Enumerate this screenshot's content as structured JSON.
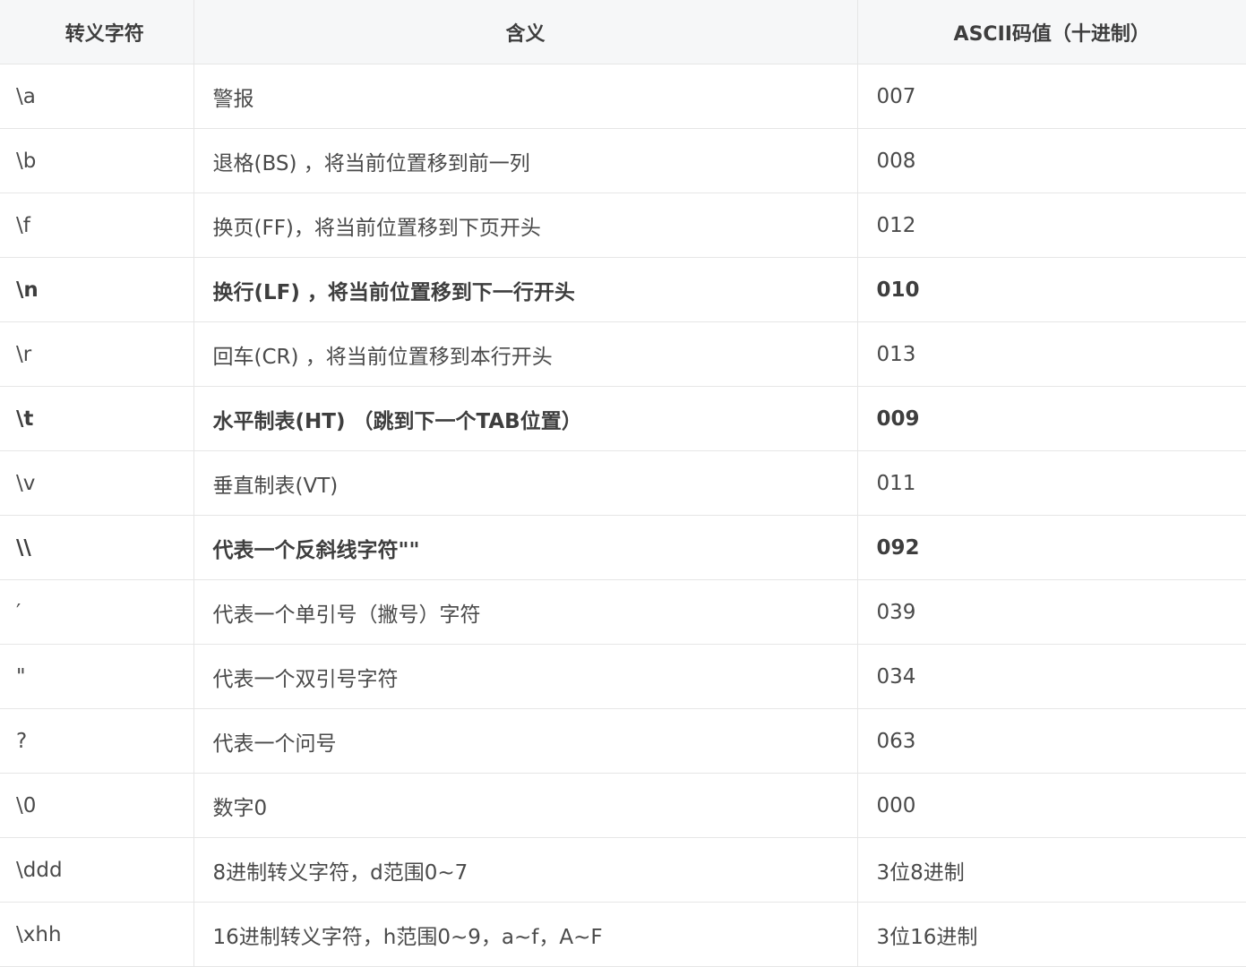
{
  "headers": [
    "转义字符",
    "含义",
    "ASCII码值（十进制）"
  ],
  "rows": [
    {
      "escape": "\\a",
      "meaning": "警报",
      "value": "007",
      "bold": false
    },
    {
      "escape": "\\b",
      "meaning": "退格(BS) ，将当前位置移到前一列",
      "value": "008",
      "bold": false
    },
    {
      "escape": "\\f",
      "meaning": "换页(FF)，将当前位置移到下页开头",
      "value": "012",
      "bold": false
    },
    {
      "escape": "\\n",
      "meaning": "换行(LF) ，将当前位置移到下一行开头",
      "value": "010",
      "bold": true
    },
    {
      "escape": "\\r",
      "meaning": "回车(CR) ，将当前位置移到本行开头",
      "value": "013",
      "bold": false
    },
    {
      "escape": "\\t",
      "meaning": "水平制表(HT) （跳到下一个TAB位置）",
      "value": "009",
      "bold": true
    },
    {
      "escape": "\\v",
      "meaning": "垂直制表(VT)",
      "value": "011",
      "bold": false
    },
    {
      "escape": "\\\\",
      "meaning": "代表一个反斜线字符\"\"",
      "value": "092",
      "bold": true
    },
    {
      "escape": "′",
      "meaning": "代表一个单引号（撇号）字符",
      "value": "039",
      "bold": false
    },
    {
      "escape": "\"",
      "meaning": "代表一个双引号字符",
      "value": "034",
      "bold": false
    },
    {
      "escape": "?",
      "meaning": "代表一个问号",
      "value": "063",
      "bold": false
    },
    {
      "escape": "\\0",
      "meaning": "数字0",
      "value": "000",
      "bold": false
    },
    {
      "escape": "\\ddd",
      "meaning": "8进制转义字符，d范围0~7",
      "value": "3位8进制",
      "bold": false
    },
    {
      "escape": "\\xhh",
      "meaning": "16进制转义字符，h范围0~9，a~f，A~F",
      "value": "3位16进制",
      "bold": false
    }
  ]
}
